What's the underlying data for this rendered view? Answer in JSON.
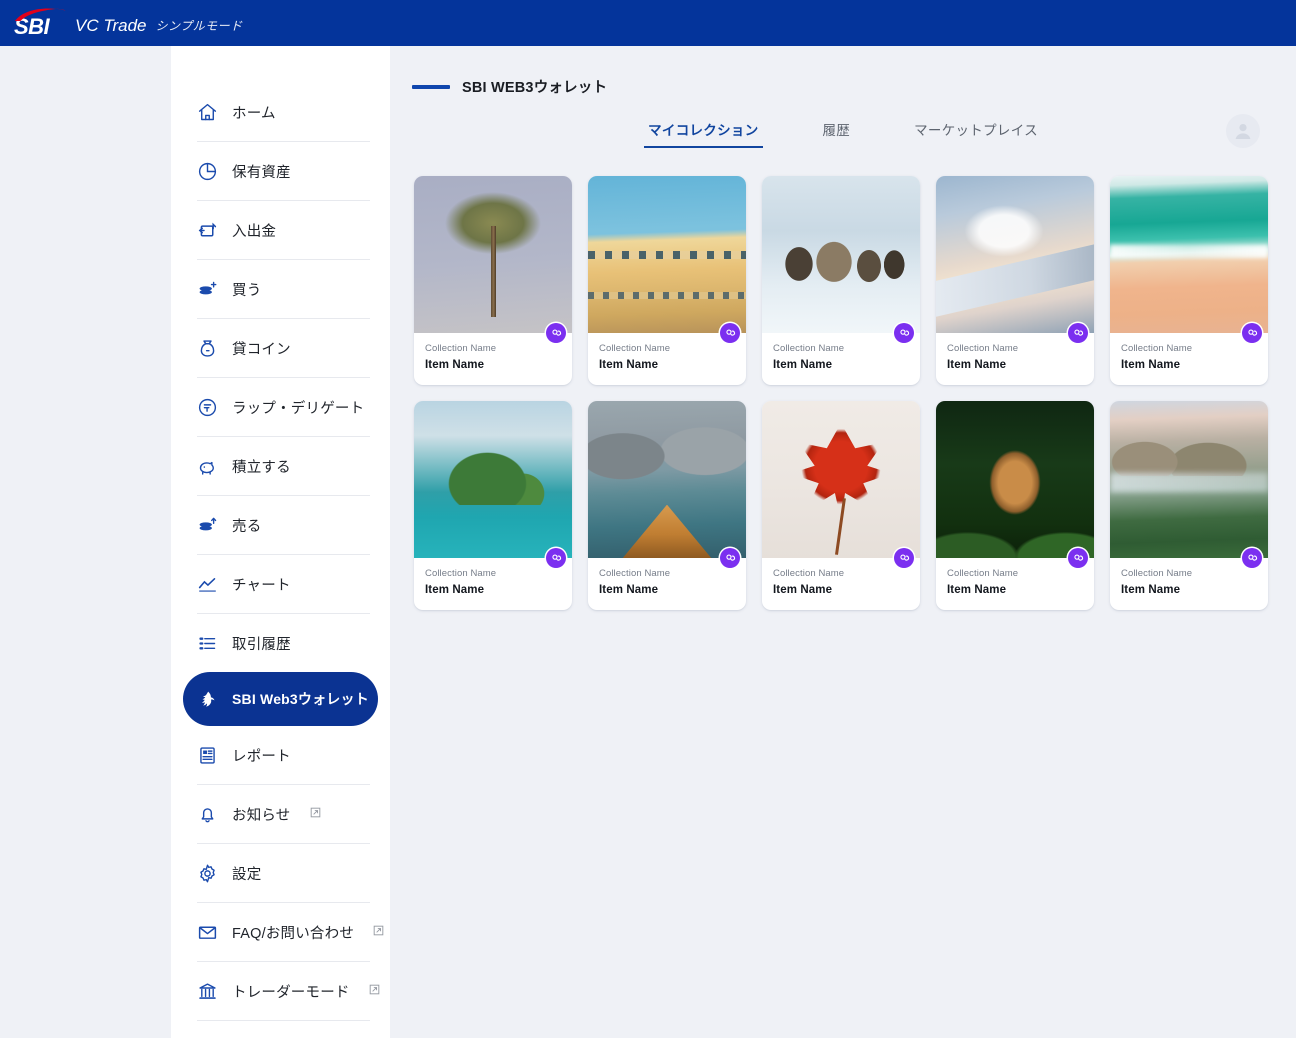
{
  "header": {
    "logo_text": "SBI",
    "product_name": "VC Trade",
    "mode_label": "シンプルモード",
    "brand_color": "#04349b",
    "logo_accent_color": "#e2001a"
  },
  "sidebar": {
    "items": [
      {
        "label": "ホーム",
        "icon": "home-icon",
        "external": false,
        "active": false
      },
      {
        "label": "保有資産",
        "icon": "pie-chart-icon",
        "external": false,
        "active": false
      },
      {
        "label": "入出金",
        "icon": "transfer-icon",
        "external": false,
        "active": false
      },
      {
        "label": "買う",
        "icon": "coins-plus-icon",
        "external": false,
        "active": false
      },
      {
        "label": "貸コイン",
        "icon": "coin-bag-icon",
        "external": false,
        "active": false
      },
      {
        "label": "ラップ・デリゲート",
        "icon": "wrap-delegate-icon",
        "external": false,
        "active": false
      },
      {
        "label": "積立する",
        "icon": "piggy-bank-icon",
        "external": false,
        "active": false
      },
      {
        "label": "売る",
        "icon": "coins-up-icon",
        "external": false,
        "active": false
      },
      {
        "label": "チャート",
        "icon": "line-chart-icon",
        "external": false,
        "active": false
      },
      {
        "label": "取引履歴",
        "icon": "list-icon",
        "external": false,
        "active": false
      },
      {
        "label": "SBI Web3ウォレット",
        "icon": "wallet-fox-icon",
        "external": false,
        "active": true
      },
      {
        "label": "レポート",
        "icon": "report-icon",
        "external": false,
        "active": false
      },
      {
        "label": "お知らせ",
        "icon": "bell-icon",
        "external": true,
        "active": false
      },
      {
        "label": "設定",
        "icon": "gear-icon",
        "external": false,
        "active": false
      },
      {
        "label": "FAQ/お問い合わせ",
        "icon": "mail-icon",
        "external": true,
        "active": false
      },
      {
        "label": "トレーダーモード",
        "icon": "bank-icon",
        "external": true,
        "active": false
      }
    ],
    "active_bg_color": "#0b3392"
  },
  "main": {
    "page_title": "SBI WEB3ウォレット",
    "title_marker_color": "#0f46ad",
    "avatar_icon": "user-avatar-icon",
    "tabs": [
      {
        "label": "マイコレクション",
        "active": true
      },
      {
        "label": "履歴",
        "active": false
      },
      {
        "label": "マーケットプレイス",
        "active": false
      }
    ],
    "tab_active_color": "#11459f",
    "chain_badge": {
      "icon": "polygon-chain-icon",
      "color": "#7b2ff0"
    },
    "cards": [
      {
        "collection": "Collection Name",
        "item": "Item Name",
        "thumb": "palm-tree-photo",
        "thumb_class": "ph-palm"
      },
      {
        "collection": "Collection Name",
        "item": "Item Name",
        "thumb": "yellow-building-photo",
        "thumb_class": "ph-building"
      },
      {
        "collection": "Collection Name",
        "item": "Item Name",
        "thumb": "reindeer-snow-photo",
        "thumb_class": "ph-deer"
      },
      {
        "collection": "Collection Name",
        "item": "Item Name",
        "thumb": "airplane-wing-photo",
        "thumb_class": "ph-wing"
      },
      {
        "collection": "Collection Name",
        "item": "Item Name",
        "thumb": "aerial-beach-photo",
        "thumb_class": "ph-beach"
      },
      {
        "collection": "Collection Name",
        "item": "Item Name",
        "thumb": "tropical-island-photo",
        "thumb_class": "ph-island"
      },
      {
        "collection": "Collection Name",
        "item": "Item Name",
        "thumb": "mountain-lake-boat-photo",
        "thumb_class": "ph-boat"
      },
      {
        "collection": "Collection Name",
        "item": "Item Name",
        "thumb": "red-maple-leaf-photo",
        "thumb_class": "ph-leaf"
      },
      {
        "collection": "Collection Name",
        "item": "Item Name",
        "thumb": "squirrel-forest-photo",
        "thumb_class": "ph-squirrel"
      },
      {
        "collection": "Collection Name",
        "item": "Item Name",
        "thumb": "misty-valley-photo",
        "thumb_class": "ph-valley"
      }
    ]
  }
}
